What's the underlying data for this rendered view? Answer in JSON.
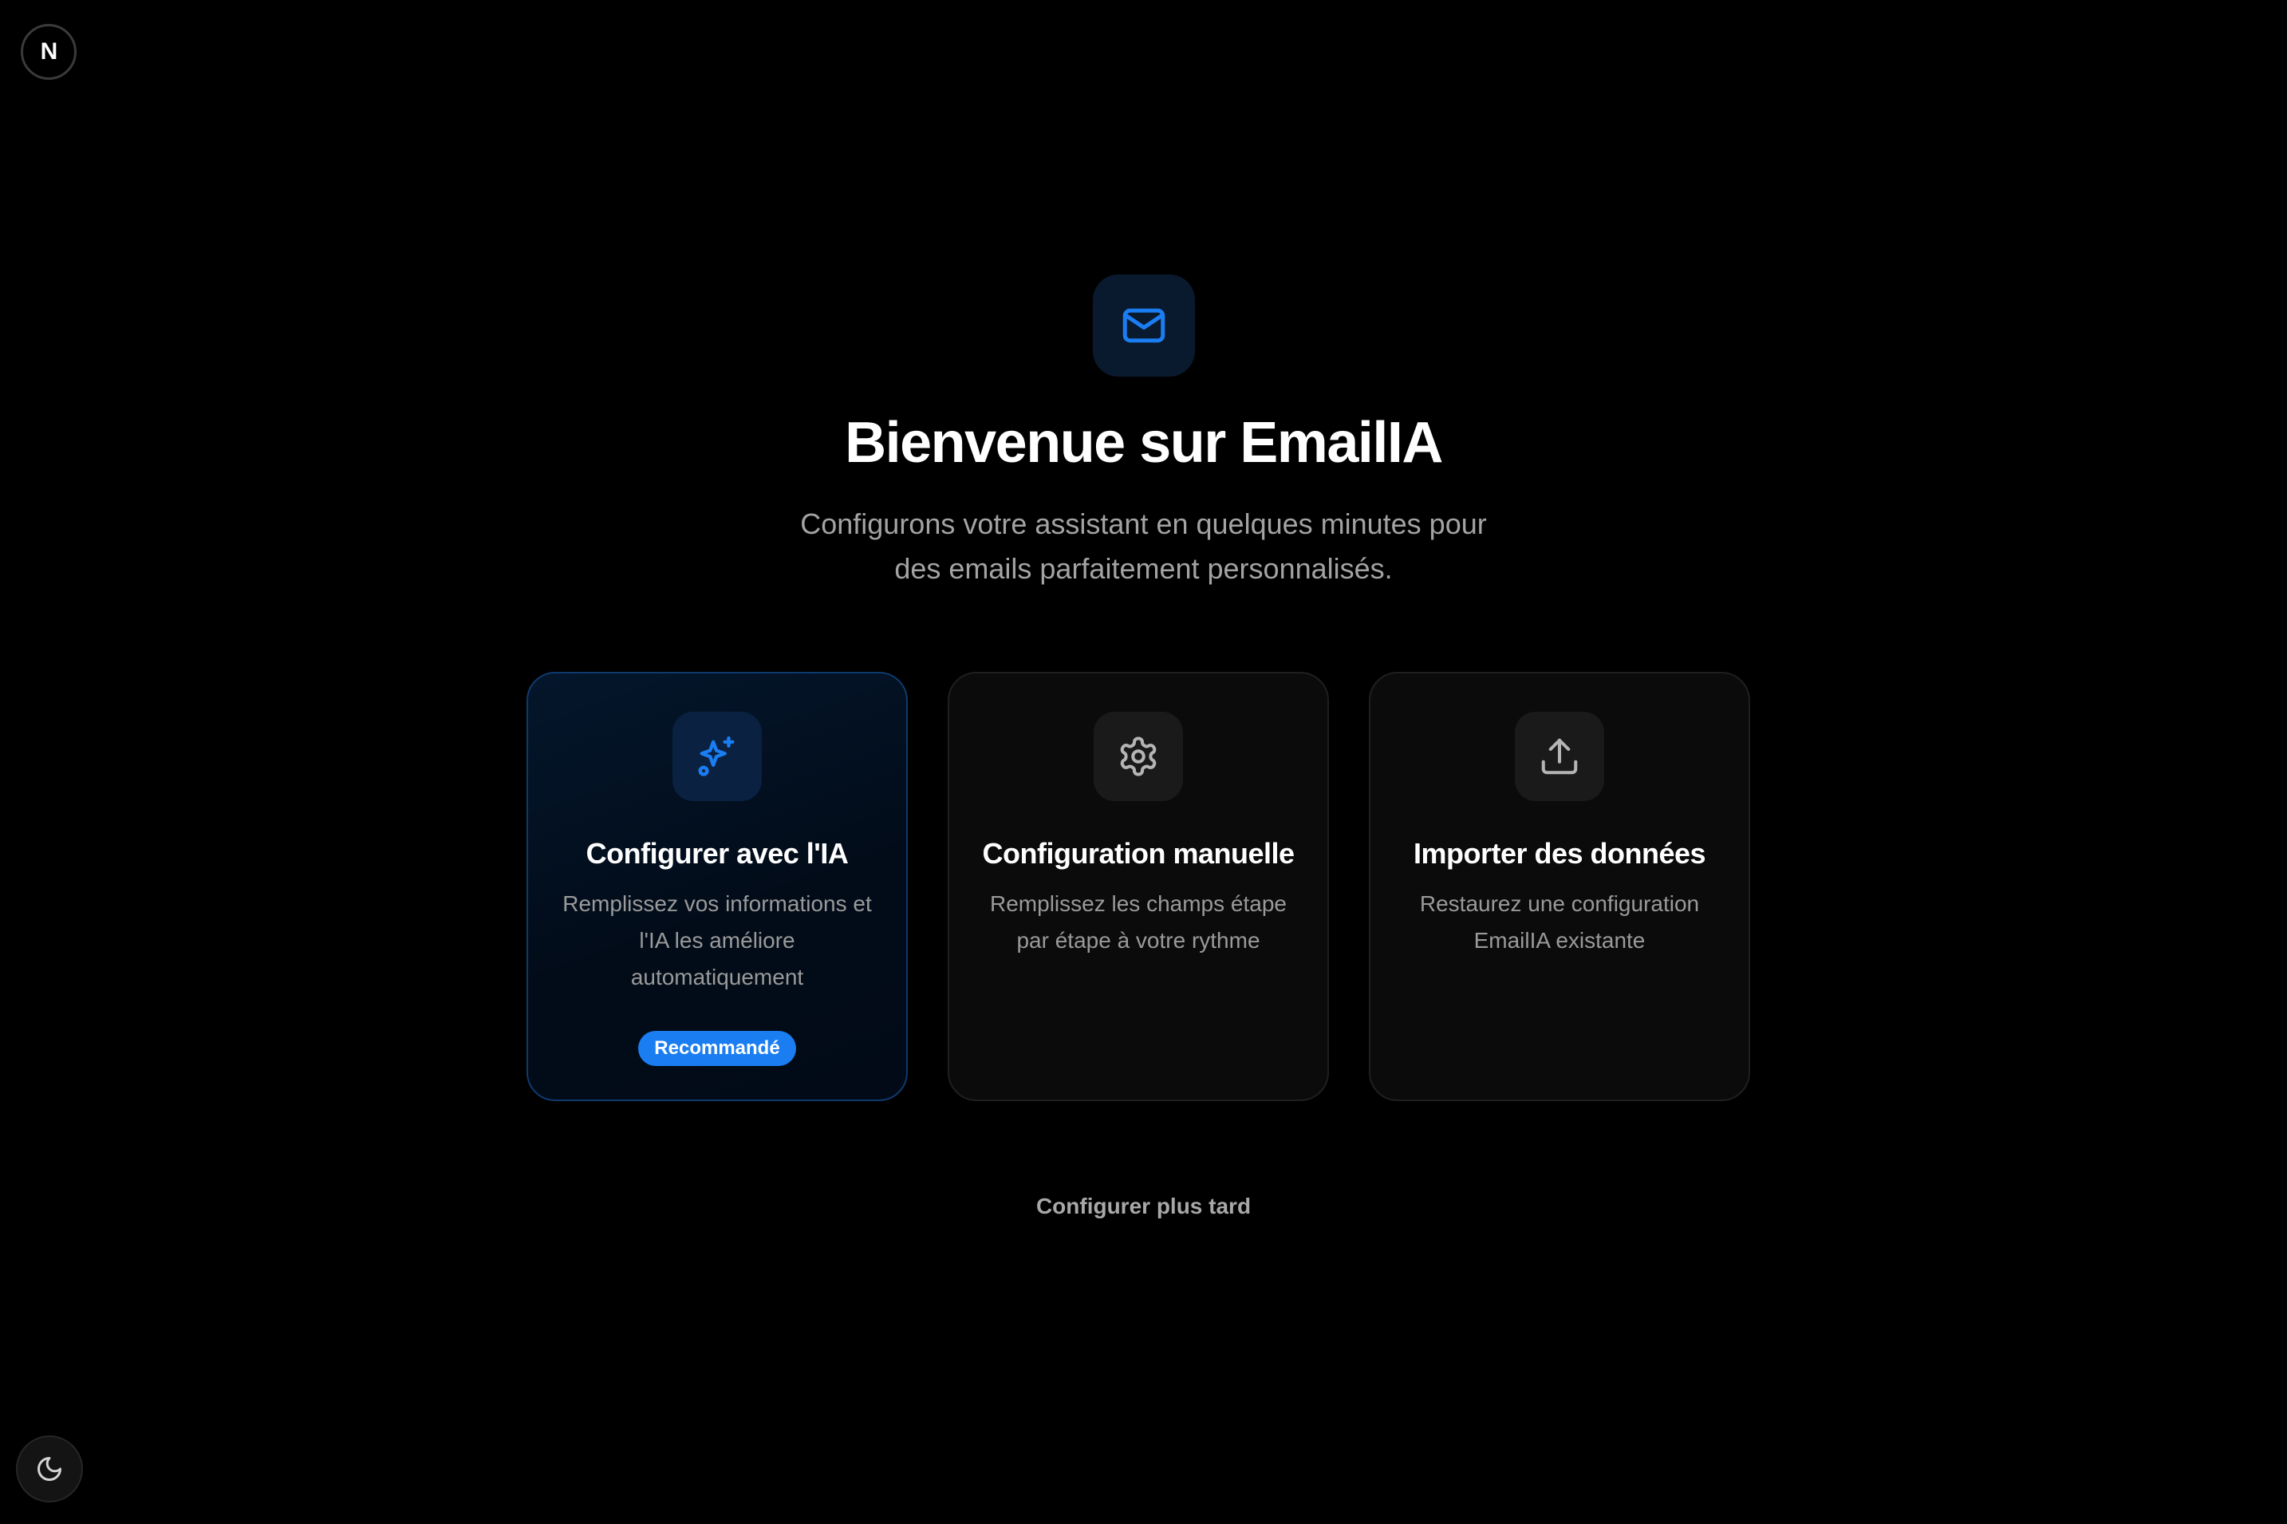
{
  "app": {
    "logo_letter": "N",
    "icon": "mail-icon",
    "title": "Bienvenue sur EmailIA",
    "subtitle": "Configurons votre assistant en quelques minutes pour des emails parfaitement personnalisés.",
    "accent_color": "#1a7ef2"
  },
  "cards": [
    {
      "icon": "sparkles-icon",
      "title": "Configurer avec l'IA",
      "description": "Remplissez vos informations et l'IA les améliore automatiquement",
      "badge": "Recommandé"
    },
    {
      "icon": "gear-icon",
      "title": "Configuration manuelle",
      "description": "Remplissez les champs étape par étape à votre rythme"
    },
    {
      "icon": "upload-icon",
      "title": "Importer des données",
      "description": "Restaurez une configuration EmailIA existante"
    }
  ],
  "footer": {
    "later_label": "Configurer plus tard"
  },
  "theme_toggle": {
    "icon": "moon-icon"
  }
}
